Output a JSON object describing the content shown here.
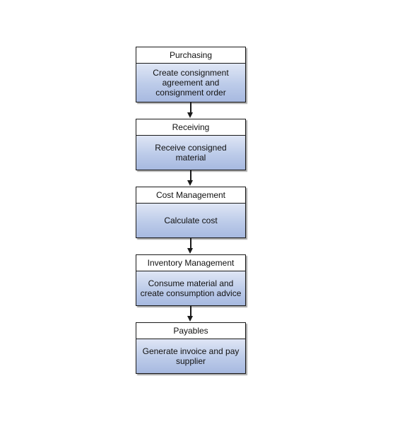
{
  "diagram": {
    "type": "flowchart",
    "direction": "top-to-bottom",
    "colors": {
      "border": "#1a1a1a",
      "header_fill": "#ffffff",
      "body_fill_top": "#dfe6f5",
      "body_fill_bottom": "#a7b9e0"
    },
    "steps": [
      {
        "header": "Purchasing",
        "body": "Create consignment agreement and consignment order"
      },
      {
        "header": "Receiving",
        "body": "Receive consigned material"
      },
      {
        "header": "Cost Management",
        "body": "Calculate cost"
      },
      {
        "header": "Inventory Management",
        "body": "Consume material and create consumption advice"
      },
      {
        "header": "Payables",
        "body": "Generate invoice and pay supplier"
      }
    ],
    "edges": [
      {
        "from": "Purchasing",
        "to": "Receiving"
      },
      {
        "from": "Receiving",
        "to": "Cost Management"
      },
      {
        "from": "Cost Management",
        "to": "Inventory Management"
      },
      {
        "from": "Inventory Management",
        "to": "Payables"
      }
    ]
  }
}
